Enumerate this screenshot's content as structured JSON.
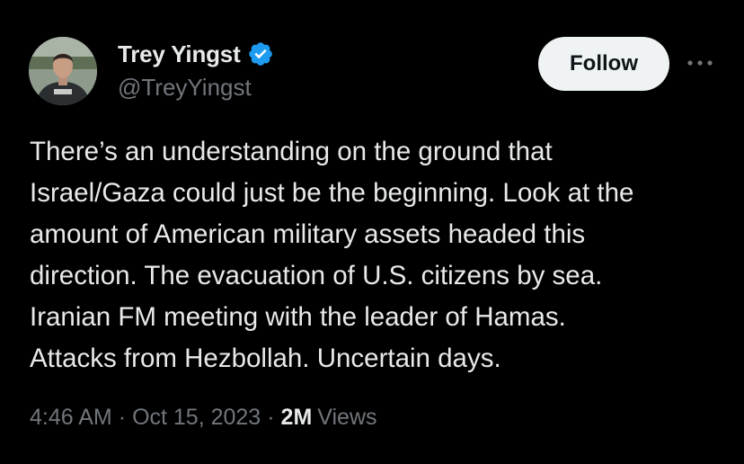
{
  "tweet": {
    "author": {
      "display_name": "Trey Yingst",
      "handle": "@TreyYingst",
      "verified_icon": "verified-badge-icon"
    },
    "follow_label": "Follow",
    "more_icon": "more-options-icon",
    "text": "There’s an understanding on the ground that\nIsrael/Gaza could just be the beginning. Look at the\namount of American military assets headed this\ndirection. The evacuation of U.S. citizens by sea.\nIranian FM meeting with the leader of Hamas.\nAttacks from Hezbollah. Uncertain days.",
    "time": "4:46 AM",
    "separator": "·",
    "date": "Oct 15, 2023",
    "views_count": "2M",
    "views_label": "Views"
  },
  "colors": {
    "background": "#000000",
    "primary_text": "#e7e9ea",
    "secondary_text": "#71767b",
    "verified_blue": "#1d9bf0",
    "follow_button_bg": "#eff3f4"
  }
}
